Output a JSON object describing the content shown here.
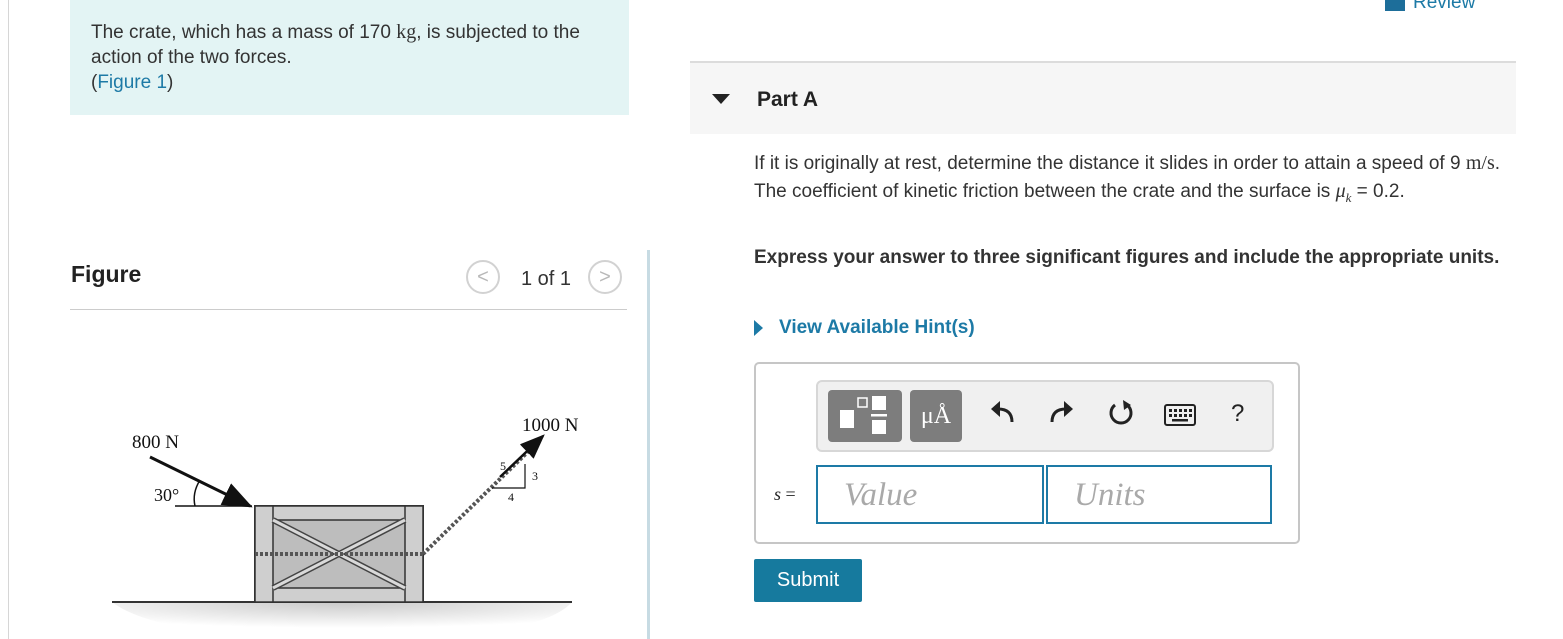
{
  "intro": {
    "text_before": "The crate, which has a mass of 170 ",
    "mass_unit": "kg",
    "text_after": ", is subjected to the action of the two forces.",
    "figure_link": "Figure 1",
    "open_paren": "(",
    "close_paren": ")"
  },
  "figure": {
    "title": "Figure",
    "pager": {
      "prev": "<",
      "count": "1 of 1",
      "next": ">"
    },
    "labels": {
      "force_left": "800 N",
      "angle": "30°",
      "force_right": "1000 N",
      "slope_hyp": "5",
      "slope_rise": "3",
      "slope_run": "4"
    }
  },
  "review": {
    "label": "Review"
  },
  "part_a": {
    "title": "Part A",
    "question": {
      "text1": "If it is originally at rest, determine the distance it slides in order to attain a speed of 9 ",
      "speed_unit": "m/s",
      "text2": ". The coefficient of kinetic friction between the crate and the surface is ",
      "mu_symbol": "μ",
      "mu_sub": "k",
      "mu_value": " = 0.2."
    },
    "instructions": "Express your answer to three significant figures and include the appropriate units.",
    "hint_label": "View Available Hint(s)",
    "toolbar": {
      "symbols_label": "μÅ",
      "help_label": "?",
      "icons": [
        "templates-icon",
        "symbols-icon",
        "undo-icon",
        "redo-icon",
        "reset-icon",
        "keyboard-icon",
        "help-icon"
      ]
    },
    "answer": {
      "variable": "s",
      "equals": "=",
      "value_placeholder": "Value",
      "units_placeholder": "Units"
    },
    "submit_label": "Submit"
  },
  "colors": {
    "accent": "#1d7aa6",
    "intro_bg": "#e3f4f4",
    "submit_bg": "#167a9e",
    "toolbar_button": "#7d7d7d"
  }
}
